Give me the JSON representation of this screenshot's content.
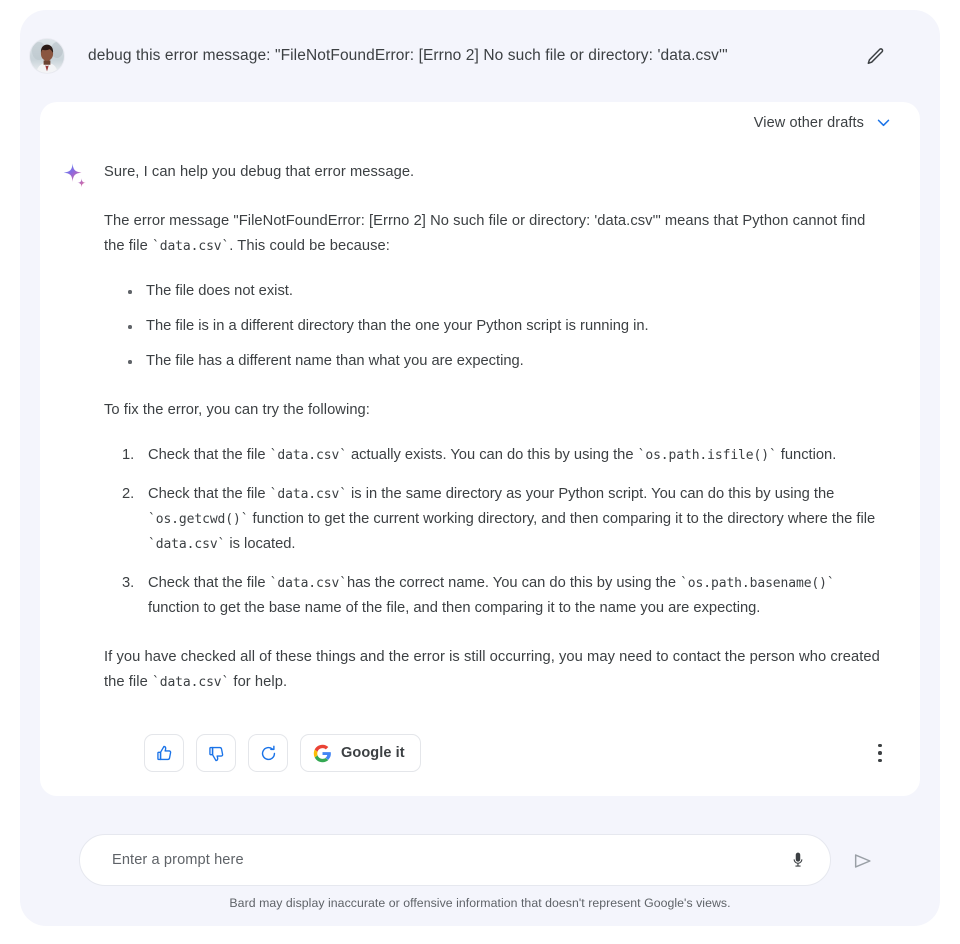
{
  "user_message": {
    "avatar_name": "user-avatar",
    "text": "debug this error message: \"FileNotFoundError: [Errno 2] No such file or directory: 'data.csv'\"",
    "edit_label": "edit-icon"
  },
  "response": {
    "drafts_label": "View other drafts",
    "intro": "Sure, I can help you debug that error message.",
    "explanation_pre": "The error message \"FileNotFoundError: [Errno 2] No such file or directory: 'data.csv'\" means that Python cannot find the file ",
    "explanation_code": "`data.csv`",
    "explanation_post": ". This could be because:",
    "causes": [
      "The file does not exist.",
      "The file is in a different directory than the one your Python script is running in.",
      "The file has a different name than what you are expecting."
    ],
    "fix_intro": "To fix the error, you can try the following:",
    "steps": [
      {
        "a": "Check that the file ",
        "c1": "`data.csv`",
        "b": " actually exists. You can do this by using the ",
        "c2": "`os.path.isfile()`",
        "d": " function."
      },
      {
        "a": "Check that the file ",
        "c1": "`data.csv`",
        "b": " is in the same directory as your Python script. You can do this by using the ",
        "c2": "`os.getcwd()`",
        "d": " function to get the current working directory, and then comparing it to the directory where the file ",
        "c3": "`data.csv`",
        "e": " is located."
      },
      {
        "a": "Check that the file ",
        "c1": "`data.csv`",
        "b": "has the correct name. You can do this by using the ",
        "c2": "`os.path.basename()`",
        "d": " function to get the base name of the file, and then comparing it to the name you are expecting."
      }
    ],
    "closing_pre": "If you have checked all of these things and the error is still occurring, you may need to contact the person who created the file ",
    "closing_code": "`data.csv`",
    "closing_post": " for help.",
    "actions": {
      "thumbs_up": "thumb-up-icon",
      "thumbs_down": "thumb-down-icon",
      "regenerate": "refresh-icon",
      "google_it": "Google it",
      "more": "more-options-icon"
    }
  },
  "composer": {
    "placeholder": "Enter a prompt here",
    "value": "",
    "mic": "microphone-icon",
    "send": "send-icon"
  },
  "footer": {
    "disclaimer": "Bard may display inaccurate or offensive information that doesn't represent Google's views."
  },
  "colors": {
    "panel_bg": "#f4f5fc",
    "card_bg": "#ffffff",
    "accent_blue": "#1a73e8",
    "text": "#3c4043",
    "muted": "#5f6368"
  }
}
